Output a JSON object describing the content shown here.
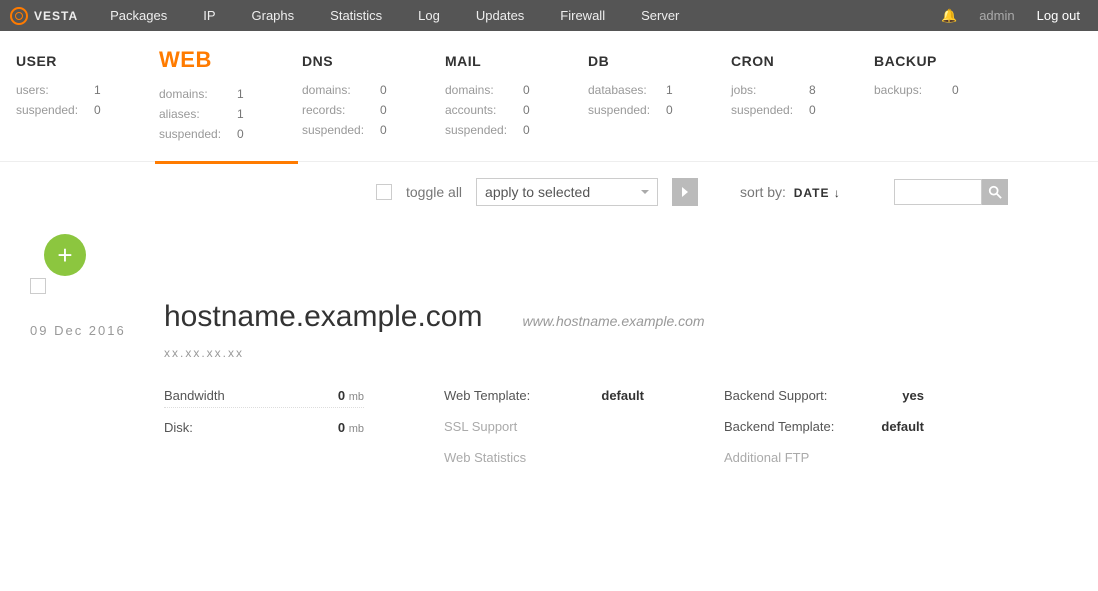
{
  "brand": "VESTA",
  "topnav": [
    "Packages",
    "IP",
    "Graphs",
    "Statistics",
    "Log",
    "Updates",
    "Firewall",
    "Server"
  ],
  "topright": {
    "admin": "admin",
    "logout": "Log out"
  },
  "stats": [
    {
      "key": "USER",
      "lines": [
        {
          "k": "users:",
          "v": "1"
        },
        {
          "k": "suspended:",
          "v": "0"
        }
      ]
    },
    {
      "key": "WEB",
      "active": true,
      "lines": [
        {
          "k": "domains:",
          "v": "1"
        },
        {
          "k": "aliases:",
          "v": "1"
        },
        {
          "k": "suspended:",
          "v": "0"
        }
      ]
    },
    {
      "key": "DNS",
      "lines": [
        {
          "k": "domains:",
          "v": "0"
        },
        {
          "k": "records:",
          "v": "0"
        },
        {
          "k": "suspended:",
          "v": "0"
        }
      ]
    },
    {
      "key": "MAIL",
      "lines": [
        {
          "k": "domains:",
          "v": "0"
        },
        {
          "k": "accounts:",
          "v": "0"
        },
        {
          "k": "suspended:",
          "v": "0"
        }
      ]
    },
    {
      "key": "DB",
      "lines": [
        {
          "k": "databases:",
          "v": "1"
        },
        {
          "k": "suspended:",
          "v": "0"
        }
      ]
    },
    {
      "key": "CRON",
      "lines": [
        {
          "k": "jobs:",
          "v": "8"
        },
        {
          "k": "suspended:",
          "v": "0"
        }
      ]
    },
    {
      "key": "BACKUP",
      "lines": [
        {
          "k": "backups:",
          "v": "0"
        }
      ]
    }
  ],
  "toolbar": {
    "toggle": "toggle all",
    "apply": "apply to selected",
    "sortlabel": "sort by:",
    "sortval": "DATE ↓"
  },
  "card": {
    "date": "09 Dec 2016",
    "domain": "hostname.example.com",
    "alias": "www.hostname.example.com",
    "ip": "xx.xx.xx.xx",
    "bandwidth_label": "Bandwidth",
    "bandwidth_val": "0",
    "bandwidth_unit": "mb",
    "disk_label": "Disk:",
    "disk_val": "0",
    "disk_unit": "mb",
    "webtpl_label": "Web Template:",
    "webtpl_val": "default",
    "ssl_label": "SSL Support",
    "webstat_label": "Web Statistics",
    "backend_support_label": "Backend Support:",
    "backend_support_val": "yes",
    "backend_tpl_label": "Backend Template:",
    "backend_tpl_val": "default",
    "addftp_label": "Additional FTP"
  }
}
